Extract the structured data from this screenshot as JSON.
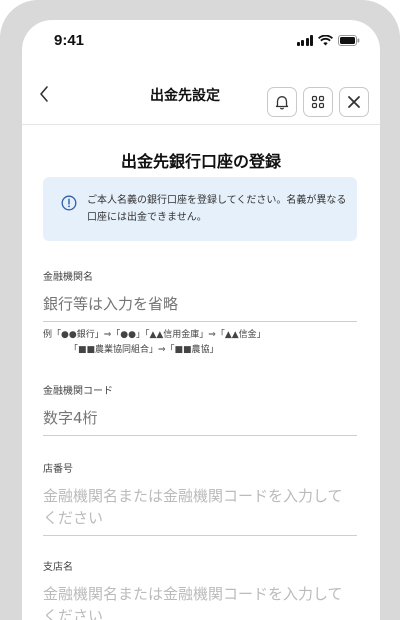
{
  "status_bar": {
    "time": "9:41"
  },
  "header": {
    "title": "出金先設定"
  },
  "page_title": "出金先銀行口座の登録",
  "notice": {
    "text": "ご本人名義の銀行口座を登録してください。名義が異なる口座には出金できません。"
  },
  "fields": {
    "bank_name": {
      "label": "金融機関名",
      "placeholder": "銀行等は入力を省略",
      "example_line1": "例「●●銀行」⇒「●●」「▲▲信用金庫」⇒「▲▲信金」",
      "example_line2": "「■■農業協同組合」⇒「■■農協」"
    },
    "bank_code": {
      "label": "金融機関コード",
      "placeholder": "数字4桁"
    },
    "branch_number": {
      "label": "店番号",
      "placeholder": "金融機関名または金融機関コードを入力してください"
    },
    "branch_name": {
      "label": "支店名",
      "placeholder": "金融機関名または金融機関コードを入力してください"
    }
  },
  "colors": {
    "notice_bg": "#e6f0fb",
    "placeholder": "#bbbbbb",
    "frame": "#d9d9d9"
  },
  "icons": [
    "back-chevron-icon",
    "bell-icon",
    "grid-icon",
    "close-icon",
    "info-icon",
    "signal-icon",
    "wifi-icon",
    "battery-icon"
  ]
}
